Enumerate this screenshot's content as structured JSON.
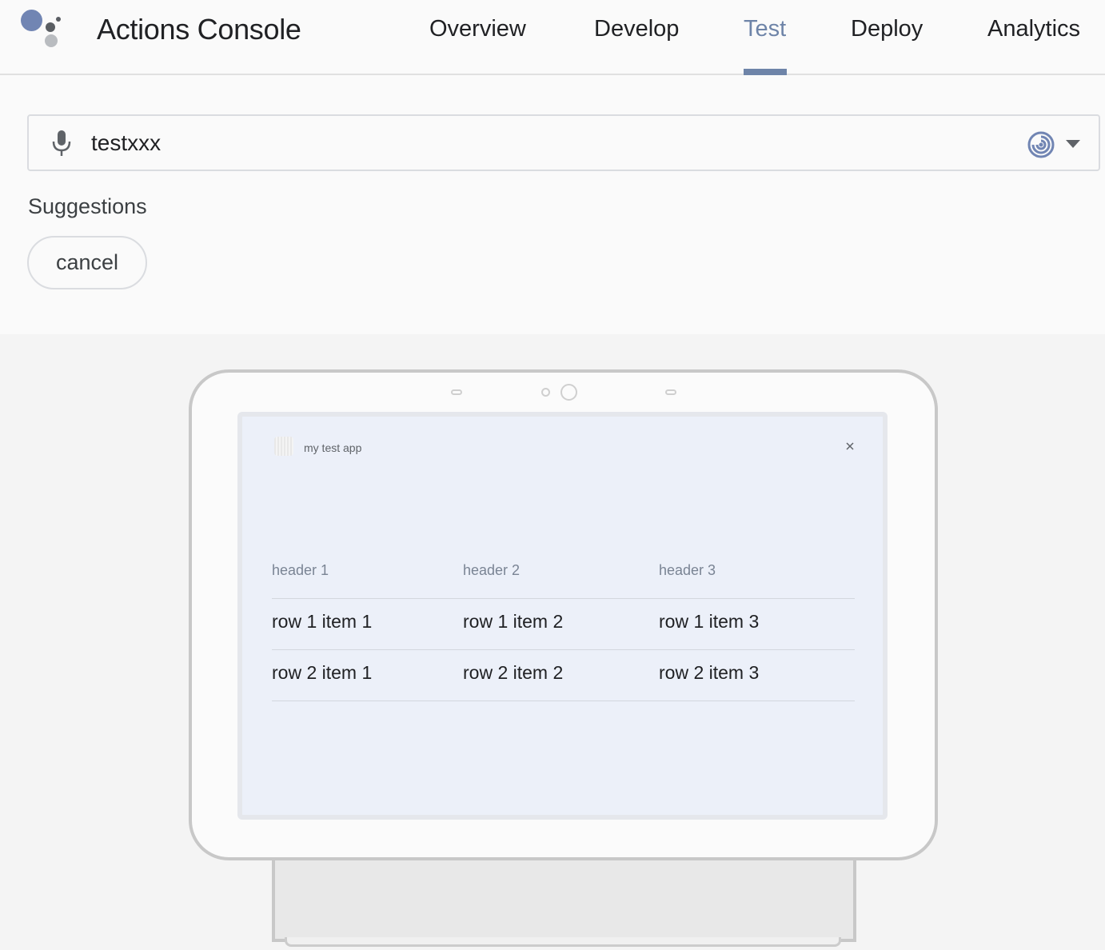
{
  "header": {
    "title": "Actions Console",
    "tabs": [
      {
        "label": "Overview",
        "active": false
      },
      {
        "label": "Develop",
        "active": false
      },
      {
        "label": "Test",
        "active": true
      },
      {
        "label": "Deploy",
        "active": false
      },
      {
        "label": "Analytics",
        "active": false
      }
    ]
  },
  "input": {
    "value": "testxxx",
    "mic_icon": "mic-icon",
    "device_icon": "device-selector-icon",
    "dropdown_icon": "chevron-down-icon"
  },
  "suggestions": {
    "label": "Suggestions",
    "chips": [
      "cancel"
    ]
  },
  "device": {
    "app_name": "my test app",
    "close_icon": "close-icon",
    "table": {
      "headers": [
        "header 1",
        "header 2",
        "header 3"
      ],
      "rows": [
        [
          "row 1 item 1",
          "row 1 item 2",
          "row 1 item 3"
        ],
        [
          "row 2 item 1",
          "row 2 item 2",
          "row 2 item 3"
        ]
      ]
    }
  },
  "colors": {
    "accent": "#6e84a8",
    "logo_blue": "#7185b3",
    "logo_dark": "#5a5e63",
    "logo_grey": "#b9bcc0",
    "screen_bg": "#ecf0f9"
  }
}
